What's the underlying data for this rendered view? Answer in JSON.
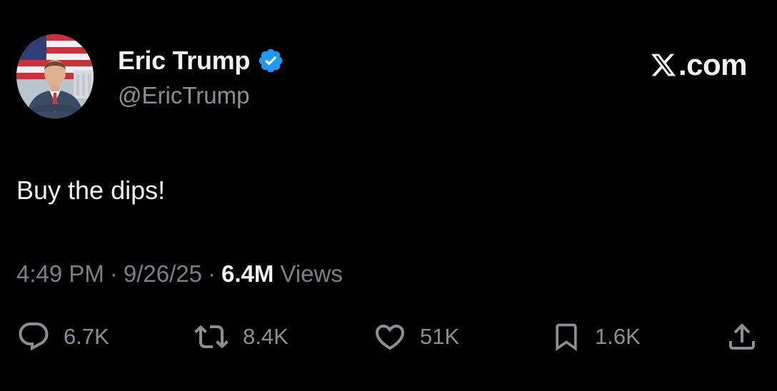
{
  "author": {
    "display_name": "Eric Trump",
    "handle": "@EricTrump",
    "verified": true
  },
  "brand": {
    "label": ".com",
    "icon": "x-logo-icon"
  },
  "tweet": {
    "text": "Buy the dips!"
  },
  "meta": {
    "time": "4:49 PM",
    "separator": "·",
    "date": "9/26/25",
    "views_count": "6.4M",
    "views_label": "Views"
  },
  "actions": {
    "replies": "6.7K",
    "retweets": "8.4K",
    "likes": "51K",
    "bookmarks": "1.6K"
  },
  "colors": {
    "background": "#000000",
    "primary_text": "#e7e9ea",
    "secondary_text": "#8b8f93",
    "verified_blue": "#1d9bf0"
  }
}
